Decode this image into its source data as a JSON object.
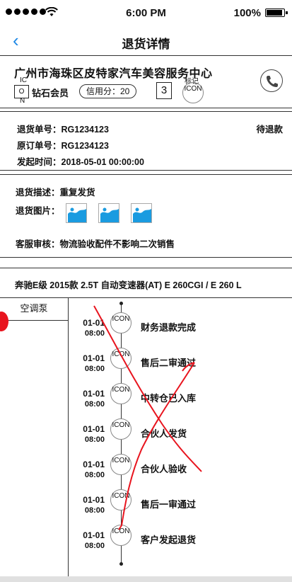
{
  "status_bar": {
    "time": "6:00 PM",
    "battery": "100%",
    "battery_level": 0.95
  },
  "nav": {
    "back_icon": "chevron-left-icon",
    "title": "退货详情"
  },
  "shop": {
    "name": "广州市海珠区皮特家汽车美容服务中心",
    "tag_icon_top": "IC",
    "tag_icon_mid": "O",
    "tag_icon_bottom": "N",
    "member_level": "钻石会员",
    "credit": "信用分：20",
    "count": "3",
    "mark_label": "标记",
    "mark_icon": "ICON",
    "phone_icon": "phone-icon"
  },
  "order": {
    "return_no_label": "退货单号：",
    "return_no": "RG1234123",
    "status": "待退款",
    "order_no_label": "原订单号：",
    "order_no": "RG1234123",
    "time_label": "发起时间：",
    "time": "2018-05-01 00:00:00"
  },
  "return_info": {
    "desc_label": "退货描述：",
    "desc": "重复发货",
    "images_label": "退货图片：",
    "images": [
      "image-icon",
      "image-icon",
      "image-icon"
    ],
    "review_label": "客服审核：",
    "review": "物流验收配件不影响二次销售"
  },
  "car_model": "奔驰E级 2015款 2.5T 自动变速器(AT) E 260CGI / E 260 L",
  "part_tab": "空调泵",
  "timeline": [
    {
      "date": "01-01",
      "time": "08:00",
      "icon": "ICON",
      "text": "财务退款完成"
    },
    {
      "date": "01-01",
      "time": "08:00",
      "icon": "ICON",
      "text": "售后二审通过"
    },
    {
      "date": "01-01",
      "time": "08:00",
      "icon": "ICON",
      "text": "中转仓已入库"
    },
    {
      "date": "01-01",
      "time": "08:00",
      "icon": "ICON",
      "text": "合伙人发货"
    },
    {
      "date": "01-01",
      "time": "08:00",
      "icon": "ICON",
      "text": "合伙人验收"
    },
    {
      "date": "01-01",
      "time": "08:00",
      "icon": "ICON",
      "text": "售后一审通过"
    },
    {
      "date": "01-01",
      "time": "08:00",
      "icon": "ICON",
      "text": "客户发起退货"
    }
  ],
  "colors": {
    "accent": "#1e88e5",
    "annotation": "#e8141e",
    "image_fill": "#1a9be0"
  }
}
